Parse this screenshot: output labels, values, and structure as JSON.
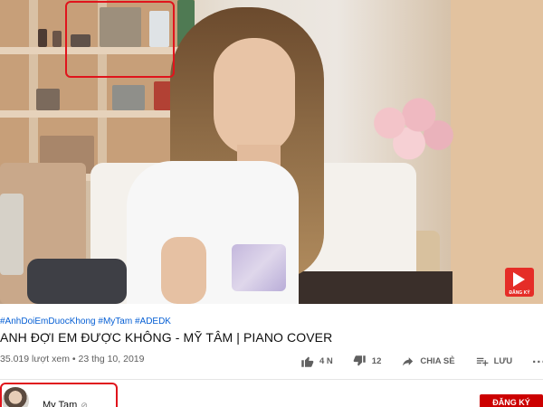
{
  "video": {
    "watermark_label": "ĐĂNG KÝ"
  },
  "info": {
    "hashtags": "#AnhDoiEmDuocKhong #MyTam #ADEDK",
    "title": "ANH ĐỢI EM ĐƯỢC KHÔNG - MỸ TÂM | PIANO COVER",
    "views": "35.019 lượt xem",
    "separator": "•",
    "date": "23 thg 10, 2019"
  },
  "actions": {
    "like_count": "4 N",
    "dislike_count": "12",
    "share_label": "CHIA SẺ",
    "save_label": "LƯU",
    "more_label": "..."
  },
  "channel": {
    "name": "My Tam",
    "verified_mark": "⊘",
    "subscribe_label": "ĐĂNG KÝ"
  },
  "icons": [
    "thumbs-up-icon",
    "thumbs-down-icon",
    "share-icon",
    "playlist-add-icon",
    "more-icon",
    "play-icon"
  ],
  "colors": {
    "annotation": "#e0141c",
    "hashtag": "#065fd4",
    "subscribe": "#cc0000",
    "secondary_text": "#606060"
  }
}
